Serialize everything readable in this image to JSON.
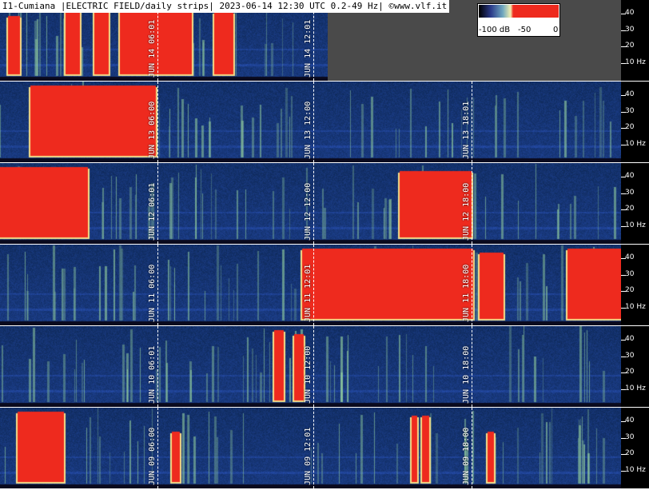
{
  "header": {
    "title": "I1-Cumiana |ELECTRIC FIELD/daily strips| 2023-06-14 12:30 UTC 0.2-49 Hz| ©www.vlf.it"
  },
  "legend": {
    "label_min": "-100 dB",
    "label_mid": "-50",
    "label_max": "0"
  },
  "axis": {
    "ticks": [
      "40",
      "30",
      "20",
      "10 Hz"
    ]
  },
  "strips": [
    {
      "markers": [
        "JUN 14 06:01",
        "JUN 14 12:01"
      ],
      "partial": true
    },
    {
      "markers": [
        "JUN 13 06:00",
        "JUN 13 12:00",
        "JUN 13 18:01"
      ]
    },
    {
      "markers": [
        "JUN 12 06:01",
        "JUN 12 12:00",
        "JUN 12 18:00"
      ]
    },
    {
      "markers": [
        "JUN 11 06:00",
        "JUN 11 12:01",
        "JUN 11 18:00"
      ]
    },
    {
      "markers": [
        "JUN 10 06:01",
        "JUN 10 12:00",
        "JUN 10 18:00"
      ]
    },
    {
      "markers": [
        "JUN 09 06:00",
        "JUN 09 12:01",
        "JUN 09 18:00"
      ]
    }
  ],
  "colors": {
    "background_blue": "#3b4f9a",
    "saturated_red": "#ee2a1e",
    "grey_fill": "#4a4a4a"
  }
}
